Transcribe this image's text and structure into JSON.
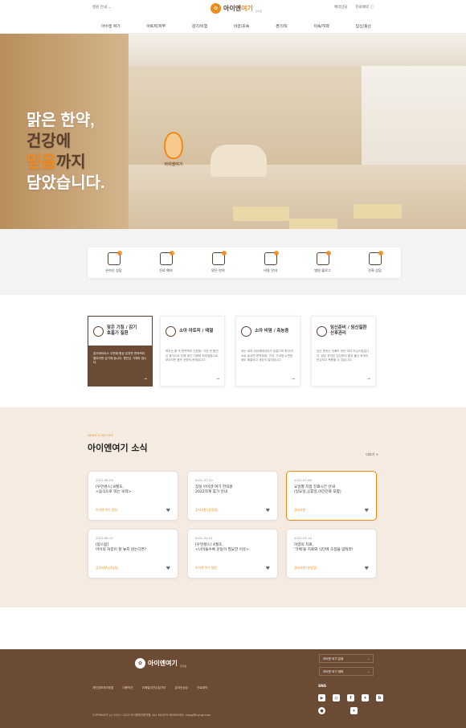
{
  "header": {
    "branch_label": "병원 안내 ⌄",
    "logo_text_a": "아이엔",
    "logo_text_b": "여기",
    "logo_sub": "한의원",
    "utils": [
      "예약상담",
      "진료예약 ⓘ"
    ],
    "gnb": [
      "아이엔 여기",
      "아토피/피부",
      "감기/비염",
      "비만/조숙",
      "경기/틱",
      "미숙/허약",
      "임신/출산"
    ]
  },
  "hero": {
    "line1": "맑은 한약,",
    "line2": "건강에",
    "line3_a": "믿음",
    "line3_b": "까지",
    "line4": "담았습니다.",
    "sign_text": "아이엔여기"
  },
  "quick": {
    "items": [
      {
        "label": "온라인 상담",
        "icon": "chat-icon"
      },
      {
        "label": "진료 예약",
        "icon": "calendar-icon"
      },
      {
        "label": "맑은 한약",
        "icon": "herbal-bowl-icon"
      },
      {
        "label": "비용 안내",
        "icon": "receipt-icon"
      },
      {
        "label": "병원 블로그",
        "icon": "laptop-icon"
      },
      {
        "label": "전화 상담",
        "icon": "phone-icon"
      }
    ]
  },
  "cards": [
    {
      "title": "잦은 기침 / 감기\n호흡기 질환",
      "desc": "감기바이러스 주변에 항상 있지만 면역력이 떨어지면 감기에 듭니다. 원인은 기체와 입니다.",
      "icon": "sick-child-icon"
    },
    {
      "title": "소아 아토피 / 태열",
      "desc": "피부는 몸 속 면역력의 신호등! 가장 큰 원인은 음식으로 인해 생긴 기체와 피부질환으로보이지만 몸속 균형의 문제입니다.",
      "icon": "child-face-icon"
    },
    {
      "title": "소아 비염 / 축농증",
      "desc": "코는 내의 외이에에이이가 호흡기의 최전선! 코로 숨쉬면 면역체계, 구취, 구내염 수면장애도 해결하고 세상이 달라집니다.",
      "icon": "child-nose-icon"
    },
    {
      "title": "임신준비 / 임신질환\n산후관리",
      "desc": "임신 준비는 아빠도 모든 여자 조심스럽습니다. 맑은 한약은 임신준비 뿐이 출산 후까지 안심하고 복용할 수 있습니다.",
      "icon": "mother-icon"
    }
  ],
  "news": {
    "eyebrow": "NEWS & NOTICE",
    "title": "아이엔여기 소식",
    "more": "더보기 +",
    "items": [
      {
        "date": "2022.08.29",
        "title": "[우먼센스] 8월호,\n<음식으로 먹는 보약>",
        "cat": "아이엔 여기 칼럼"
      },
      {
        "date": "2022.07.20",
        "title": "잠실 아이엔 여기 한의원\n2022하계 휴가 안내",
        "cat": "공지사항 (잠실점)"
      },
      {
        "date": "2022.07.08",
        "title": "요일별 지점 진료시간 안내\n(일요일,공휴일,야간진료 포함)",
        "cat": "공지사항"
      },
      {
        "date": "2022.06.15",
        "title": "[맘스팁]\n아이의 처증이 잘 놓지 않는다면?",
        "cat": "공지사항 (강남점)"
      },
      {
        "date": "2022.04.01",
        "title": "[우먼센스] 4월호,\n<나이들수록 운동이 필요한 이유>",
        "cat": "아이엔 여기 칼럼"
      },
      {
        "date": "2022.03.14",
        "title": "어렸의 치료,\n'기체'을 치료와 식단에 초점을 맞춰라!",
        "cat": "공지사항 (분당점)"
      }
    ]
  },
  "footer": {
    "logo_text": "아이엔여기",
    "logo_sub": "한의원",
    "links": [
      "개인정보처리방침",
      "이용약관",
      "이메일무단수집거부",
      "온라인상담",
      "진료예약"
    ],
    "copyright": "COPYRIGHT (c) 2012~2022 아이엔여기한의원. ALL RIGHTS RESERVED.  inqsg@inyngi.com",
    "select1": "아이엔 여기 분점",
    "select2": "아이엔 여기 캠퍼",
    "sns_label": "SNS",
    "sns_row1": [
      "youtube-icon",
      "instagram-icon",
      "facebook-icon",
      "twitter-icon",
      "blog-icon"
    ],
    "sns_row2": [
      "kakao-icon",
      "twitter-icon"
    ]
  },
  "colors": {
    "accent": "#f08a1c",
    "brown": "#6b4b33",
    "news_bg": "#f6ebe0"
  }
}
